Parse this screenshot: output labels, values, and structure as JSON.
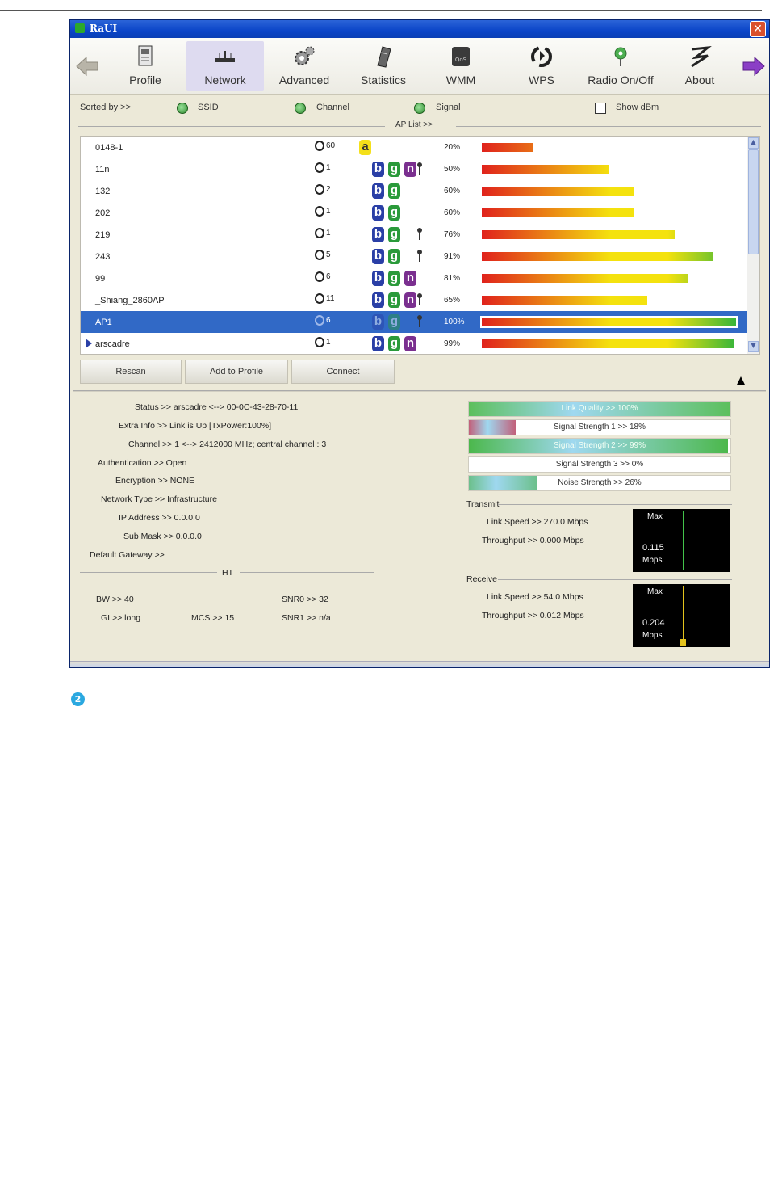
{
  "window": {
    "title": "RaUI",
    "close_glyph": "✕"
  },
  "toolbar": {
    "items": [
      {
        "label": "Profile",
        "icon": "profile-icon"
      },
      {
        "label": "Network",
        "icon": "router-icon"
      },
      {
        "label": "Advanced",
        "icon": "gears-icon"
      },
      {
        "label": "Statistics",
        "icon": "notebook-icon"
      },
      {
        "label": "WMM",
        "icon": "wmm-icon"
      },
      {
        "label": "WPS",
        "icon": "wps-icon"
      },
      {
        "label": "Radio On/Off",
        "icon": "radio-icon"
      },
      {
        "label": "About",
        "icon": "about-icon"
      }
    ],
    "active": "Network"
  },
  "sort": {
    "label": "Sorted by >>",
    "options": [
      "SSID",
      "Channel",
      "Signal"
    ],
    "show_dbm": "Show dBm",
    "ap_list_label": "AP List >>"
  },
  "ap_list": [
    {
      "ssid": "0148-1",
      "channel": "60",
      "modes": [
        "a"
      ],
      "wps": false,
      "signal": "20%",
      "value": 20
    },
    {
      "ssid": "11n",
      "channel": "1",
      "modes": [
        "b",
        "g",
        "n"
      ],
      "wps": true,
      "signal": "50%",
      "value": 50
    },
    {
      "ssid": "132",
      "channel": "2",
      "modes": [
        "b",
        "g"
      ],
      "wps": false,
      "signal": "60%",
      "value": 60
    },
    {
      "ssid": "202",
      "channel": "1",
      "modes": [
        "b",
        "g"
      ],
      "wps": false,
      "signal": "60%",
      "value": 60
    },
    {
      "ssid": "219",
      "channel": "1",
      "modes": [
        "b",
        "g"
      ],
      "wps": true,
      "signal": "76%",
      "value": 76
    },
    {
      "ssid": "243",
      "channel": "5",
      "modes": [
        "b",
        "g"
      ],
      "wps": true,
      "signal": "91%",
      "value": 91
    },
    {
      "ssid": "99",
      "channel": "6",
      "modes": [
        "b",
        "g",
        "n"
      ],
      "wps": false,
      "signal": "81%",
      "value": 81
    },
    {
      "ssid": "_Shiang_2860AP",
      "channel": "11",
      "modes": [
        "b",
        "g",
        "n"
      ],
      "wps": true,
      "signal": "65%",
      "value": 65
    },
    {
      "ssid": "AP1",
      "channel": "6",
      "modes": [
        "b",
        "g"
      ],
      "wps": true,
      "signal": "100%",
      "value": 100,
      "selected": true
    },
    {
      "ssid": "arscadre",
      "channel": "1",
      "modes": [
        "b",
        "g",
        "n"
      ],
      "wps": false,
      "signal": "99%",
      "value": 99,
      "connected": true
    }
  ],
  "buttons": {
    "rescan": "Rescan",
    "add_to_profile": "Add to Profile",
    "connect": "Connect"
  },
  "info": {
    "status": "Status >> arscadre <--> 00-0C-43-28-70-11",
    "extra_info": "Extra Info >> Link is Up [TxPower:100%]",
    "channel": "Channel >> 1 <--> 2412000 MHz; central channel : 3",
    "authentication": "Authentication >> Open",
    "encryption": "Encryption >> NONE",
    "network_type": "Network Type >> Infrastructure",
    "ip_address": "IP Address >> 0.0.0.0",
    "sub_mask": "Sub Mask >> 0.0.0.0",
    "default_gateway": "Default Gateway >>",
    "ht_label": "HT",
    "bw": "BW >> 40",
    "gi": "GI >> long",
    "mcs": "MCS >> 15",
    "snr0": "SNR0 >> 32",
    "snr1": "SNR1 >> n/a"
  },
  "meters": [
    {
      "label": "Link Quality >> 100%",
      "value": 100,
      "color": "#5cbf5c"
    },
    {
      "label": "Signal Strength 1 >> 18%",
      "value": 18,
      "color": "#c2607a"
    },
    {
      "label": "Signal Strength 2 >> 99%",
      "value": 99,
      "color": "#4cb84c"
    },
    {
      "label": "Signal Strength 3 >> 0%",
      "value": 0,
      "color": "#4cb84c"
    },
    {
      "label": "Noise Strength >> 26%",
      "value": 26,
      "color": "#6cc08c"
    }
  ],
  "transmit": {
    "label": "Transmit",
    "link_speed": "Link Speed >> 270.0 Mbps",
    "throughput": "Throughput >> 0.000 Mbps",
    "graph_max": "Max",
    "graph_value": "0.115",
    "graph_unit": "Mbps"
  },
  "receive": {
    "label": "Receive",
    "link_speed": "Link Speed >> 54.0 Mbps",
    "throughput": "Throughput >> 0.012 Mbps",
    "graph_max": "Max",
    "graph_value": "0.204",
    "graph_unit": "Mbps"
  },
  "step_number": "2",
  "colors": {
    "selected_row": "#3169c6",
    "titlebar": "#0b45c8",
    "badge_b": "#2a3fa6",
    "badge_g": "#2a9a3a",
    "badge_n": "#7a2f8f",
    "badge_a": "#f4e01a"
  }
}
